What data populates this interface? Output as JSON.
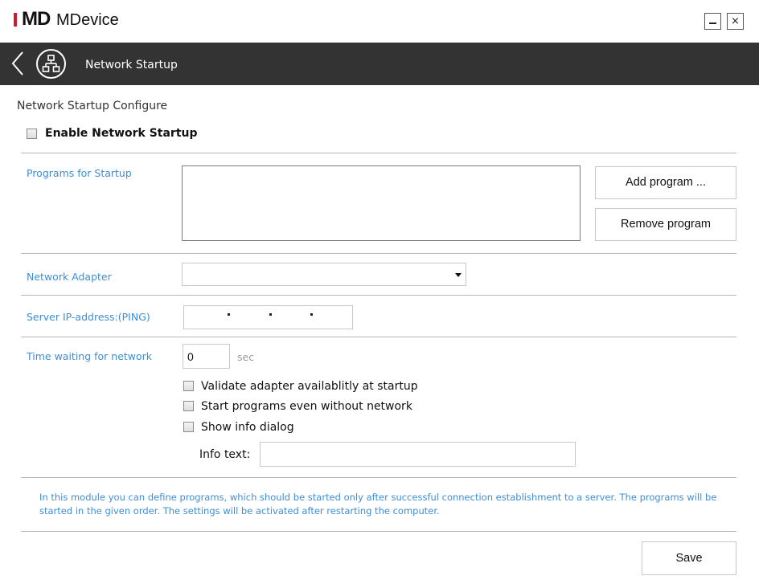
{
  "app": {
    "logo_text": "MD",
    "title": "MDevice",
    "brand_color": "#d2192e"
  },
  "window_controls": {
    "minimize_icon": "minimize-icon",
    "close_icon": "close-icon",
    "close_glyph": "×"
  },
  "header": {
    "title": "Network Startup",
    "background": "#333333",
    "back_icon": "chevron-left-icon",
    "module_icon": "network-icon"
  },
  "section": {
    "title": "Network Startup Configure",
    "enable_label": "Enable Network Startup",
    "enable_checked": false
  },
  "programs": {
    "label": "Programs for Startup",
    "items": [],
    "add_button": "Add program ...",
    "remove_button": "Remove program"
  },
  "adapter": {
    "label": "Network Adapter",
    "selected": ""
  },
  "server_ip": {
    "label": "Server IP-address:(PING)",
    "value": "   .   .   ."
  },
  "wait": {
    "label": "Time waiting for network",
    "value": "0",
    "unit": "sec"
  },
  "options": [
    {
      "label": "Validate adapter availablitly at startup",
      "checked": false
    },
    {
      "label": "Start programs even without network",
      "checked": false
    },
    {
      "label": "Show info dialog",
      "checked": false
    }
  ],
  "info_text": {
    "label": "Info text:",
    "value": ""
  },
  "footer": {
    "description": "In this module you can define programs, which should be started only after successful connection establishment to a server. The programs will be started in the given order. The settings will be activated after restarting the computer.",
    "accent_color": "#3d8ed8"
  },
  "save_button": "Save"
}
